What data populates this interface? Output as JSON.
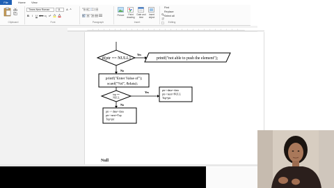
{
  "tabs": [
    {
      "label": "File"
    },
    {
      "label": "Home"
    },
    {
      "label": "View"
    }
  ],
  "ribbon": {
    "clipboard": {
      "label": "Clipboard"
    },
    "font": {
      "label": "Font",
      "family": "Times New Roman",
      "size": "11"
    },
    "paragraph": {
      "label": "Paragraph"
    },
    "insert": {
      "label": "Insert",
      "buttons": [
        {
          "label": "Picture"
        },
        {
          "label": "Paint drawing"
        },
        {
          "label": "Date and time"
        },
        {
          "label": "Insert object"
        }
      ]
    },
    "editing": {
      "label": "Editing",
      "items": [
        {
          "label": "Find"
        },
        {
          "label": "Replace"
        },
        {
          "label": "Select all"
        }
      ]
    }
  },
  "flowchart": {
    "decision": "if(ptr == NULL)",
    "yes1": "Yes",
    "output": "printf(\"not able to push the element\");",
    "no1": "No",
    "prompt": [
      "printf(\"Enter Value of\");",
      "scanf(\"%d\", &data);"
    ],
    "decision2": [
      "top ==",
      "NULL"
    ],
    "yes2": "Yes",
    "assign_right": [
      "ptr->data= data",
      "ptr->next=NULL",
      "Top=ptr"
    ],
    "no2": "No",
    "assign_bottom": [
      "ptr -> data= data",
      "ptr->next=Top",
      "Top=ptr"
    ]
  },
  "page_text": "Null",
  "colors": {
    "file_tab": "#1e5fb4",
    "ribbon_bg": "#fbfbfb",
    "workspace_bg": "#f2f2f2",
    "page_bg": "#ffffff"
  }
}
